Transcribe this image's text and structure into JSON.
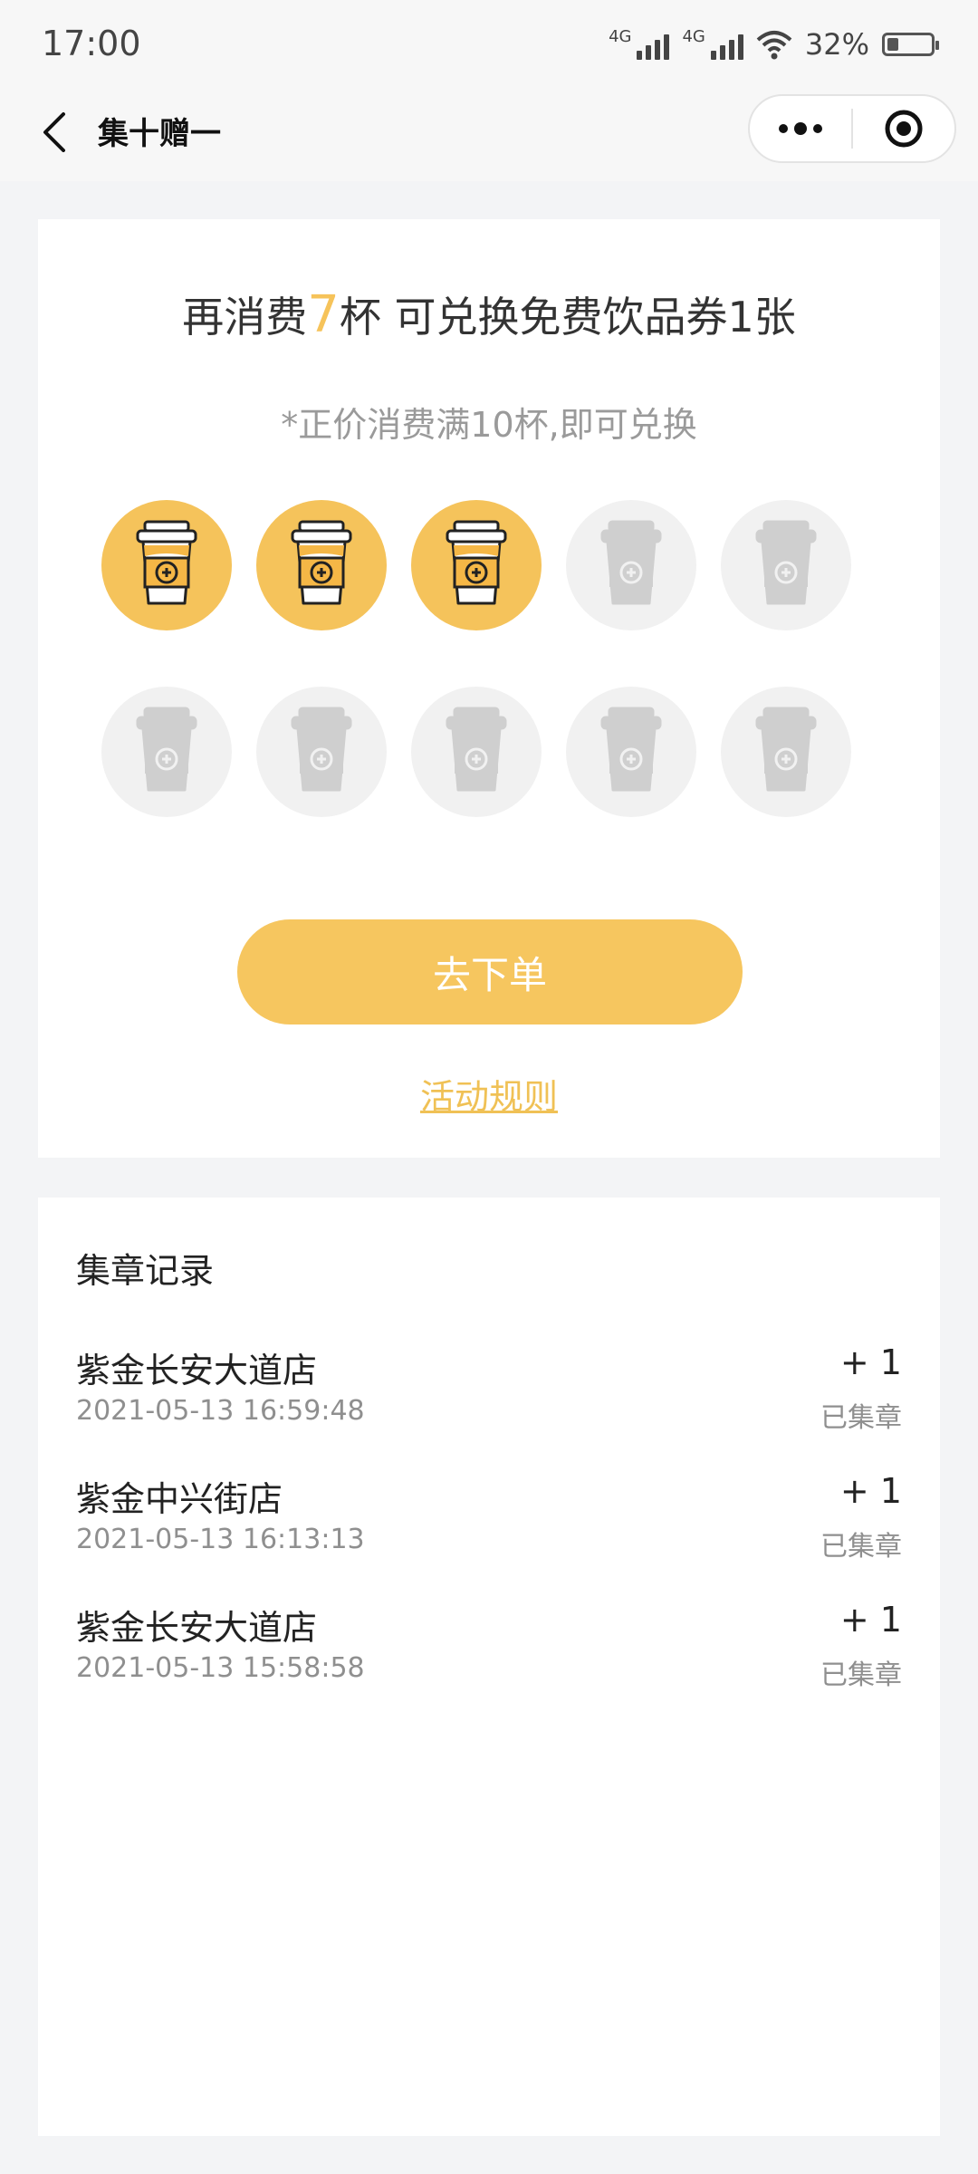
{
  "status_bar": {
    "time": "17:00",
    "network1": "4G",
    "network2": "4G",
    "battery": "32%",
    "icons": [
      "signal-icon",
      "signal-icon",
      "wifi-icon",
      "battery-icon"
    ]
  },
  "navbar": {
    "title": "集十赠一",
    "icons": [
      "back-arrow-icon",
      "more-dots-icon",
      "close-circle-icon"
    ]
  },
  "progress": {
    "prefix": "再消费",
    "remaining": "7",
    "suffix": "杯 可兑换免费饮品券1张",
    "note": "*正价消费满10杯,即可兑换",
    "collected": 3,
    "total": 10,
    "cup_icon": "coffee-cup-icon",
    "active_color": "#f5c35b",
    "inactive_color": "#f1f1f1"
  },
  "actions": {
    "order_label": "去下单",
    "rules_label": "活动规则"
  },
  "records": {
    "title": "集章记录",
    "items": [
      {
        "store": "紫金长安大道店",
        "time": "2021-05-13 16:59:48",
        "count": "+ 1",
        "status": "已集章"
      },
      {
        "store": "紫金中兴街店",
        "time": "2021-05-13 16:13:13",
        "count": "+ 1",
        "status": "已集章"
      },
      {
        "store": "紫金长安大道店",
        "time": "2021-05-13 15:58:58",
        "count": "+ 1",
        "status": "已集章"
      }
    ]
  }
}
